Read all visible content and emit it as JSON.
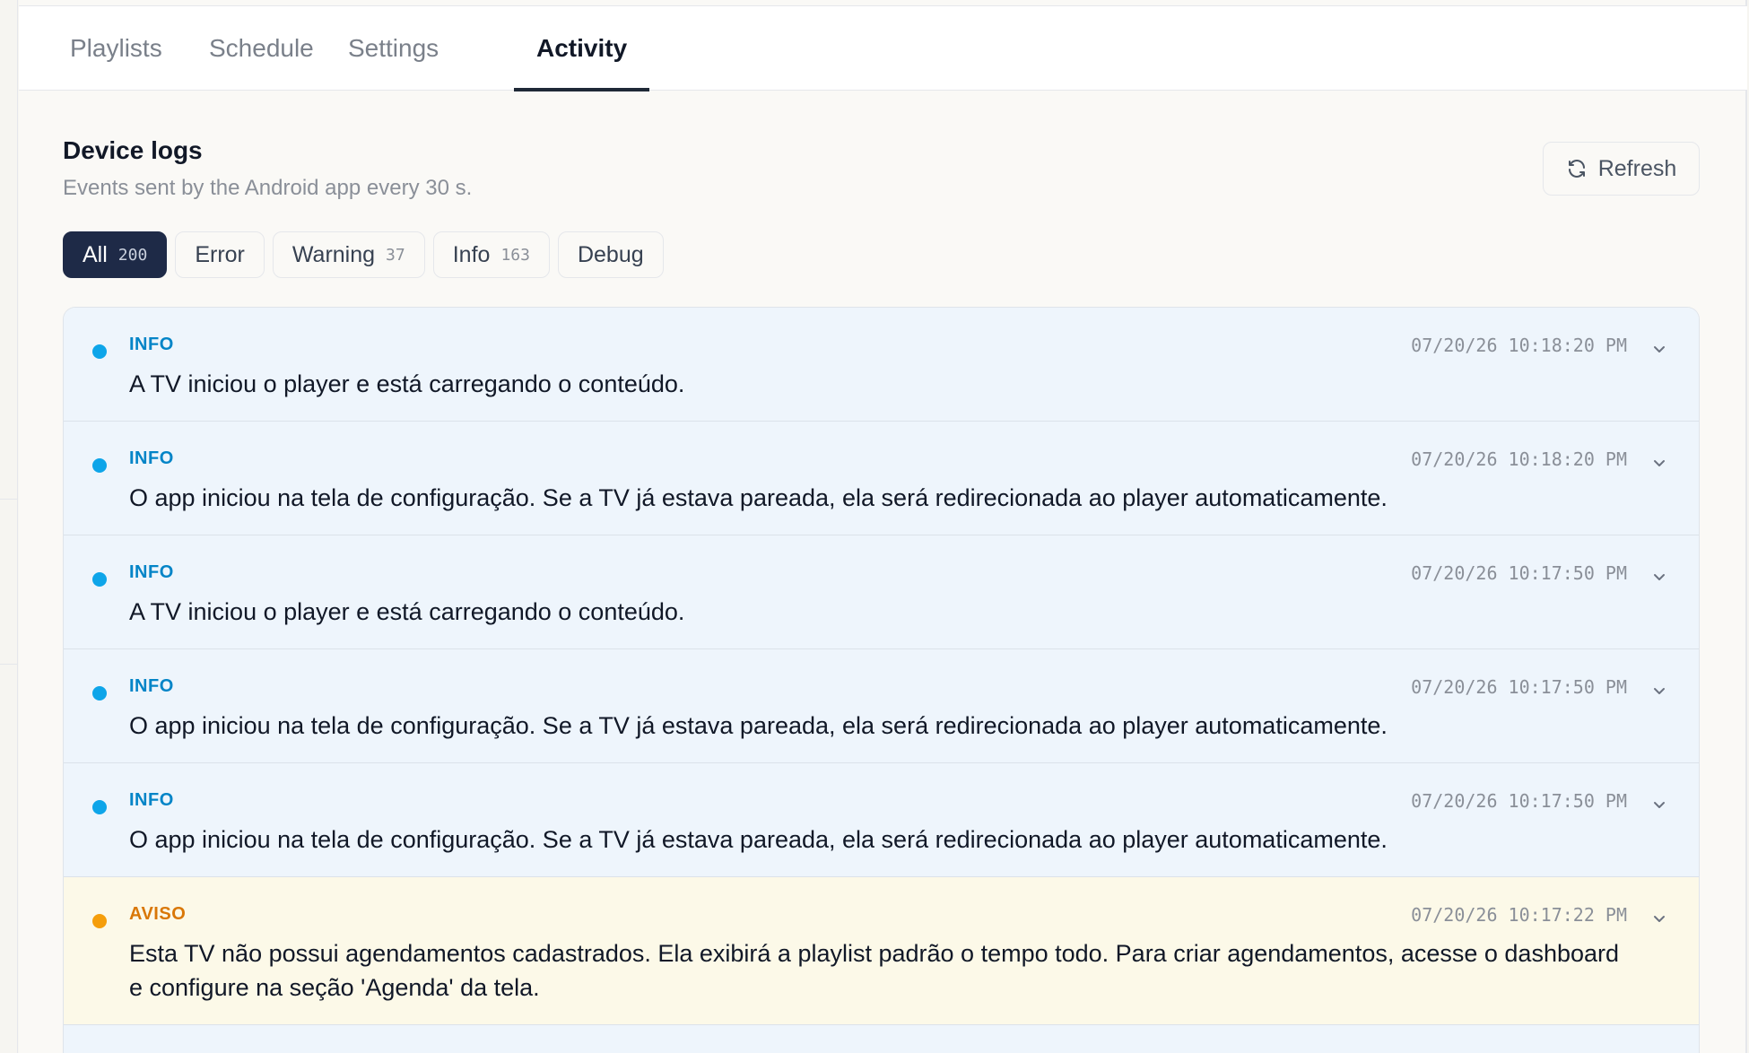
{
  "tabs": [
    {
      "label": "Playlists"
    },
    {
      "label": "Schedule"
    },
    {
      "label": "Settings"
    },
    {
      "label": "Activity",
      "active": true
    }
  ],
  "section": {
    "title": "Device logs",
    "subtitle": "Events sent by the Android app every 30 s."
  },
  "refresh": {
    "label": "Refresh",
    "icon": "refresh-icon"
  },
  "filters": [
    {
      "label": "All",
      "count": "200",
      "active": true
    },
    {
      "label": "Error",
      "count": ""
    },
    {
      "label": "Warning",
      "count": "37"
    },
    {
      "label": "Info",
      "count": "163"
    },
    {
      "label": "Debug",
      "count": ""
    }
  ],
  "logs": [
    {
      "level": "INFO",
      "time": "07/20/26 10:18:20 PM",
      "message": "A TV iniciou o player e está carregando o conteúdo."
    },
    {
      "level": "INFO",
      "time": "07/20/26 10:18:20 PM",
      "message": "O app iniciou na tela de configuração. Se a TV já estava pareada, ela será redirecionada ao player automaticamente."
    },
    {
      "level": "INFO",
      "time": "07/20/26 10:17:50 PM",
      "message": "A TV iniciou o player e está carregando o conteúdo."
    },
    {
      "level": "INFO",
      "time": "07/20/26 10:17:50 PM",
      "message": "O app iniciou na tela de configuração. Se a TV já estava pareada, ela será redirecionada ao player automaticamente."
    },
    {
      "level": "INFO",
      "time": "07/20/26 10:17:50 PM",
      "message": "O app iniciou na tela de configuração. Se a TV já estava pareada, ela será redirecionada ao player automaticamente."
    },
    {
      "level": "AVISO",
      "time": "07/20/26 10:17:22 PM",
      "message": "Esta TV não possui agendamentos cadastrados. Ela exibirá a playlist padrão o tempo todo. Para criar agendamentos, acesse o dashboard e configure na seção 'Agenda' da tela."
    }
  ],
  "colors": {
    "info": "#0ea5e9",
    "warning": "#f59e0b",
    "active_chip": "#1e2a47"
  }
}
